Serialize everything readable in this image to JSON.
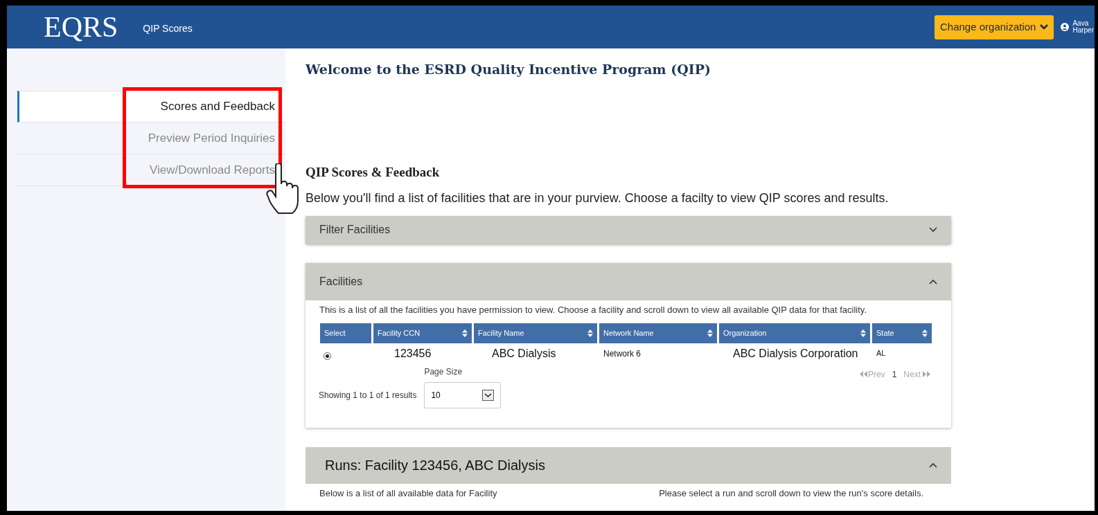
{
  "header": {
    "logo": "EQRS",
    "app_name": "QIP Scores",
    "change_org_button": "Change organization",
    "user_name": [
      "Aava",
      "Harper"
    ]
  },
  "sidebar": {
    "items": [
      {
        "label": "Scores and Feedback",
        "selected": true
      },
      {
        "label": "Preview Period Inquiries",
        "selected": false
      },
      {
        "label": "View/Download Reports",
        "selected": false
      }
    ]
  },
  "main": {
    "title": "Welcome to the ESRD Quality Incentive Program (QIP)",
    "section_title": "QIP Scores & Feedback",
    "description": "Below you'll find a list of facilities that are in your purview. Choose a facilty to view QIP scores and results.",
    "filter_panel": {
      "title": "Filter Facilities",
      "expanded": false
    },
    "facilities_panel": {
      "title": "Facilities",
      "expanded": true,
      "intro": "This is a list of all the facilities you have permission to view. Choose a facility and scroll down to view all available QIP data for that facility.",
      "columns": [
        {
          "label": "Select",
          "sortable": false
        },
        {
          "label": "Facility CCN",
          "sortable": true
        },
        {
          "label": "Facility Name",
          "sortable": true
        },
        {
          "label": "Network Name",
          "sortable": true
        },
        {
          "label": "Organization",
          "sortable": true
        },
        {
          "label": "State",
          "sortable": true
        }
      ],
      "rows": [
        {
          "selected": true,
          "cells": [
            "",
            "123456",
            "ABC Dialysis",
            "Network 6",
            "ABC Dialysis Corporation",
            "AL"
          ]
        }
      ],
      "page_size_label": "Page Size",
      "page_size": "10",
      "showing": "Showing 1 to 1 of 1 results",
      "prev": "Prev",
      "page": "1",
      "next": "Next"
    },
    "runs_panel": {
      "title": "Runs: Facility 123456, ABC Dialysis",
      "expanded": true,
      "intro_left": "Below is a list of all available data for Facility",
      "intro_right": "Please select a run and scroll down to view the run's score details."
    }
  }
}
